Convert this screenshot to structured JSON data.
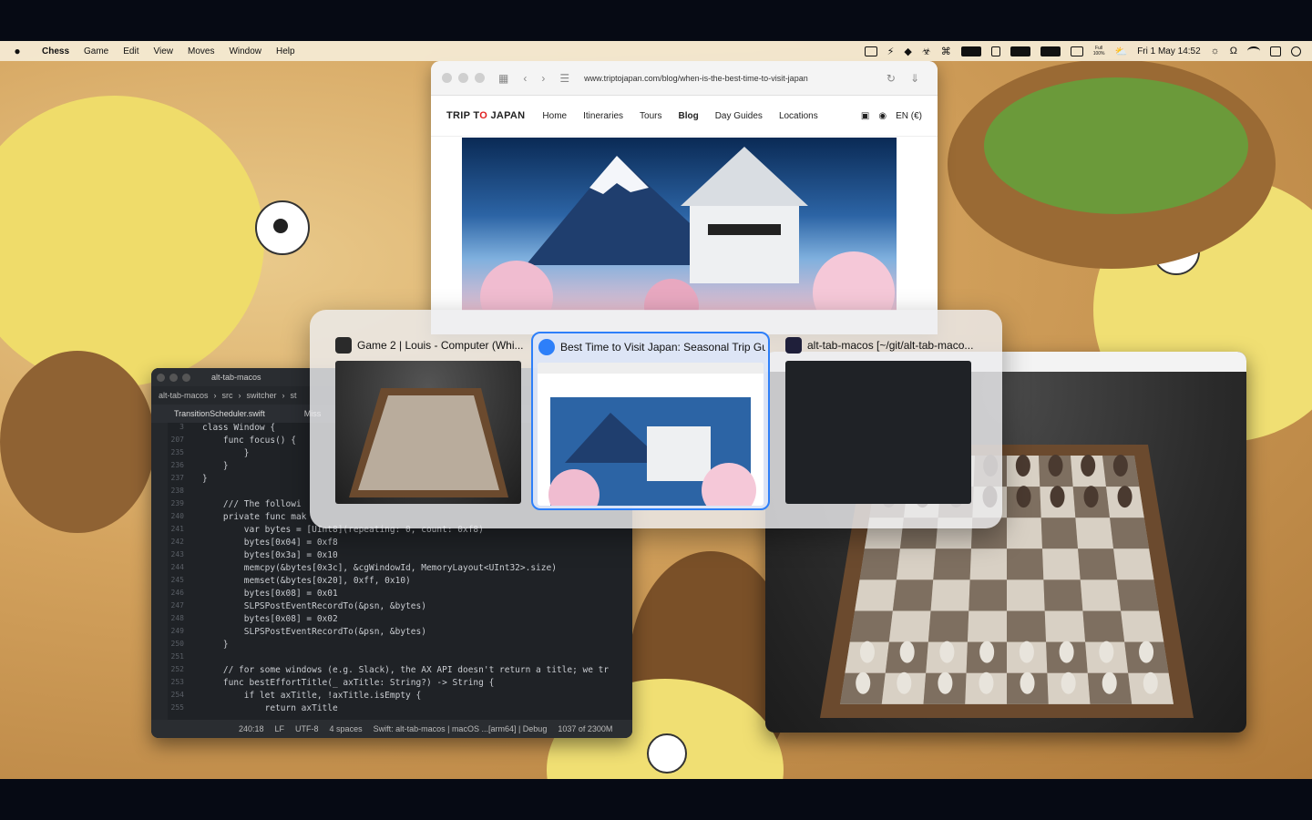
{
  "menubar": {
    "app_name": "Chess",
    "items": [
      "Game",
      "Edit",
      "View",
      "Moves",
      "Window",
      "Help"
    ],
    "battery_label": "Full\n100%",
    "datetime": "Fri 1 May 14:52"
  },
  "safari": {
    "url": "www.triptojapan.com/blog/when-is-the-best-time-to-visit-japan",
    "logo_left": "TRIP T",
    "logo_o": "O",
    "logo_right": " JAPAN",
    "nav": [
      "Home",
      "Itineraries",
      "Tours",
      "Blog",
      "Day Guides",
      "Locations"
    ],
    "lang": "EN (€)"
  },
  "editor": {
    "title": "alt-tab-macos",
    "breadcrumb": [
      "alt-tab-macos",
      "src",
      "switcher",
      "st"
    ],
    "tab_file": "TransitionScheduler.swift",
    "tab_second": "Miss",
    "lines": [
      {
        "n": "3",
        "code": "class Window {"
      },
      {
        "n": "207",
        "code": "    func focus() {"
      },
      {
        "n": "235",
        "code": "        }"
      },
      {
        "n": "236",
        "code": "    }"
      },
      {
        "n": "237",
        "code": "}"
      },
      {
        "n": "238",
        "code": ""
      },
      {
        "n": "239",
        "code": "    /// The followi"
      },
      {
        "n": "240",
        "code": "    private func mak"
      },
      {
        "n": "241",
        "code": "        var bytes = [UInt8](repeating: 0, count: 0xf8)"
      },
      {
        "n": "242",
        "code": "        bytes[0x04] = 0xf8"
      },
      {
        "n": "243",
        "code": "        bytes[0x3a] = 0x10"
      },
      {
        "n": "244",
        "code": "        memcpy(&bytes[0x3c], &cgWindowId, MemoryLayout<UInt32>.size)"
      },
      {
        "n": "245",
        "code": "        memset(&bytes[0x20], 0xff, 0x10)"
      },
      {
        "n": "246",
        "code": "        bytes[0x08] = 0x01"
      },
      {
        "n": "247",
        "code": "        SLPSPostEventRecordTo(&psn, &bytes)"
      },
      {
        "n": "248",
        "code": "        bytes[0x08] = 0x02"
      },
      {
        "n": "249",
        "code": "        SLPSPostEventRecordTo(&psn, &bytes)"
      },
      {
        "n": "250",
        "code": "    }"
      },
      {
        "n": "251",
        "code": ""
      },
      {
        "n": "252",
        "code": "    // for some windows (e.g. Slack), the AX API doesn't return a title; we tr"
      },
      {
        "n": "253",
        "code": "    func bestEffortTitle(_ axTitle: String?) -> String {"
      },
      {
        "n": "254",
        "code": "        if let axTitle, !axTitle.isEmpty {"
      },
      {
        "n": "255",
        "code": "            return axTitle"
      }
    ],
    "status": [
      "240:18",
      "LF",
      "UTF-8",
      "4 spaces",
      "Swift: alt-tab-macos | macOS ...[arm64] | Debug",
      "1037 of 2300M"
    ]
  },
  "alttab": {
    "items": [
      {
        "title": "Game 2 | Louis - Computer   (Whi...",
        "selected": false
      },
      {
        "title": "Best Time to Visit Japan: Seasonal Trip Gui...",
        "selected": true
      },
      {
        "title": "alt-tab-macos [~/git/alt-tab-maco...",
        "selected": false
      }
    ]
  }
}
